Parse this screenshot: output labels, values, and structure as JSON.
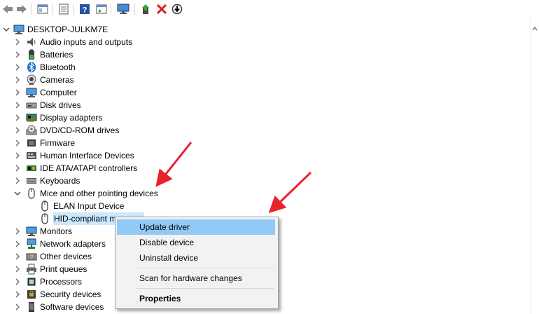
{
  "toolbar": {
    "buttons": [
      "back-icon",
      "forward-icon",
      "show-hide-console-tree-icon",
      "properties-icon",
      "help-icon",
      "action-pane-icon",
      "monitor-icon",
      "update-driver-icon",
      "uninstall-icon",
      "disable-icon"
    ]
  },
  "tree": {
    "root": "DESKTOP-JULKM7E",
    "items": [
      {
        "label": "Audio inputs and outputs",
        "icon": "speaker-icon"
      },
      {
        "label": "Batteries",
        "icon": "battery-icon"
      },
      {
        "label": "Bluetooth",
        "icon": "bluetooth-icon"
      },
      {
        "label": "Cameras",
        "icon": "camera-icon"
      },
      {
        "label": "Computer",
        "icon": "computer-icon"
      },
      {
        "label": "Disk drives",
        "icon": "disk-drive-icon"
      },
      {
        "label": "Display adapters",
        "icon": "display-adapter-icon"
      },
      {
        "label": "DVD/CD-ROM drives",
        "icon": "dvd-drive-icon"
      },
      {
        "label": "Firmware",
        "icon": "firmware-icon"
      },
      {
        "label": "Human Interface Devices",
        "icon": "hid-icon"
      },
      {
        "label": "IDE ATA/ATAPI controllers",
        "icon": "ide-controller-icon"
      },
      {
        "label": "Keyboards",
        "icon": "keyboard-icon"
      },
      {
        "label": "Mice and other pointing devices",
        "icon": "mouse-icon",
        "expanded": true
      },
      {
        "label": "ELAN Input Device",
        "icon": "mouse-icon",
        "child": true
      },
      {
        "label": "HID-compliant m",
        "icon": "mouse-icon",
        "child": true,
        "selected": true
      },
      {
        "label": "Monitors",
        "icon": "monitor-icon"
      },
      {
        "label": "Network adapters",
        "icon": "network-adapter-icon"
      },
      {
        "label": "Other devices",
        "icon": "unknown-device-icon"
      },
      {
        "label": "Print queues",
        "icon": "printer-icon"
      },
      {
        "label": "Processors",
        "icon": "processor-icon"
      },
      {
        "label": "Security devices",
        "icon": "security-device-icon"
      },
      {
        "label": "Software devices",
        "icon": "software-device-icon"
      }
    ]
  },
  "context_menu": {
    "update_driver": "Update driver",
    "disable_device": "Disable device",
    "uninstall_device": "Uninstall device",
    "scan": "Scan for hardware changes",
    "properties": "Properties"
  },
  "colors": {
    "selection": "#cce8ff",
    "menu_highlight": "#91c9f7",
    "annotation_arrow": "#e8232b"
  }
}
